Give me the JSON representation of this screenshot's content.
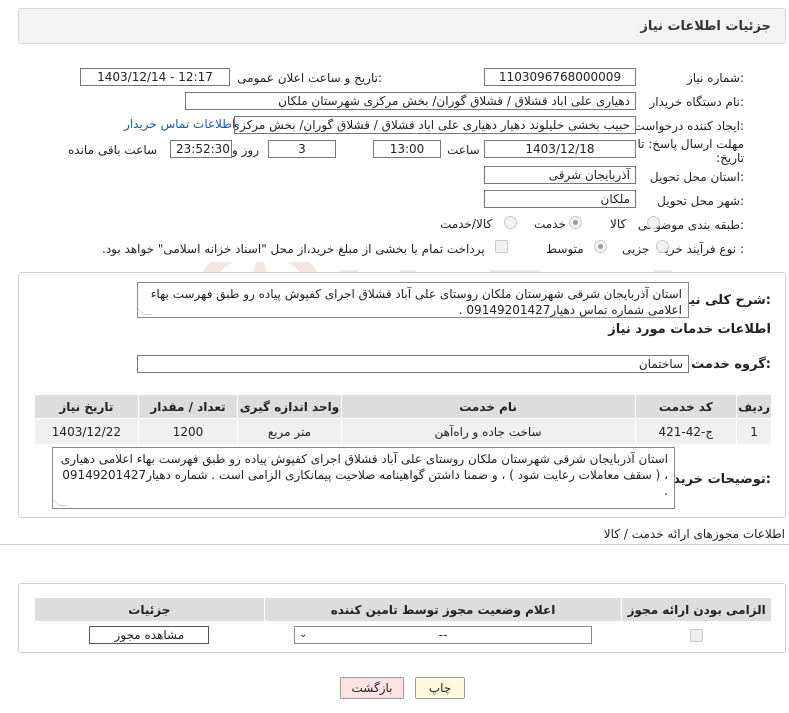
{
  "header": {
    "title": "جزئیات اطلاعات نیاز"
  },
  "form": {
    "need_number_label": "شماره نیاز:",
    "need_number": "1103096768000009",
    "announce_label": "تاریخ و ساعت اعلان عمومی:",
    "announce_value": "1403/12/14 - 12:17",
    "buyer_org_label": "نام دستگاه خریدار:",
    "buyer_org": "دهیاری علی اباد قشلاق / قشلاق گوران/ بخش مرکزی شهرستان ملکان",
    "requester_label": "ایجاد کننده درخواست:",
    "requester": "حبیب بخشی خلیلوند دهیار دهیاری علی اباد قشلاق / قشلاق گوران/ بخش مرکزی شهرستان ملکان",
    "contact_link": "اطلاعات تماس خریدار",
    "deadline_label": "مهلت ارسال پاسخ: تا تاریخ:",
    "deadline_date": "1403/12/18",
    "time_label": "ساعت",
    "deadline_time": "13:00",
    "days_value": "3",
    "days_label": "روز و",
    "remaining_time": "23:52:30",
    "remaining_label": "ساعت باقی مانده",
    "province_label": "استان محل تحویل:",
    "province": "آذربایجان شرقی",
    "city_label": "شهر محل تحویل:",
    "city": "ملکان",
    "category_label": "طبقه بندی موضوعی:",
    "category_options": [
      "کالا",
      "خدمت",
      "کالا/خدمت"
    ],
    "process_label": "نوع فرآیند خرید :",
    "process_options": [
      "جزیی",
      "متوسط"
    ],
    "payment_note": "پرداخت تمام یا بخشی از مبلغ خرید،از محل \"اسناد خزانه اسلامی\" خواهد بود."
  },
  "summary": {
    "label": "شرح کلی نیاز:",
    "text": "استان آذربایجان شرقی شهرستان ملکان روستای علی آباد قشلاق اجرای کفپوش پیاده رو  طبق فهرست بهاء اعلامی  شماره تماس دهیار09149201427 ."
  },
  "services": {
    "section_title": "اطلاعات خدمات مورد نیاز",
    "group_label": "گروه خدمت:",
    "group_value": "ساختمان",
    "columns": [
      "ردیف",
      "کد خدمت",
      "نام خدمت",
      "واحد اندازه گیری",
      "تعداد / مقدار",
      "تاریخ نیاز"
    ],
    "rows": [
      [
        "1",
        "ج-42-421",
        "ساخت جاده و راه‌آهن",
        "متر مربع",
        "1200",
        "1403/12/22"
      ]
    ]
  },
  "buyer_notes": {
    "label": "توضیحات خریدار:",
    "text": "استان آذربایجان شرقی شهرستان ملکان روستای علی آباد قشلاق اجرای کفپوش پیاده رو  طبق فهرست بهاء اعلامی دهیاری ، ( سقف معاملات رعایت شود ) ، و ضمنا داشتن گواهینامه صلاحیت پیمانکاری الزامی است . شماره دهیار09149201427 ."
  },
  "permits": {
    "section_title": "اطلاعات مجوزهای ارائه خدمت / کالا",
    "columns": [
      "الزامی بودن ارائه مجوز",
      "اعلام وضعیت مجوز توسط تامین کننده",
      "جزئیات"
    ],
    "select_value": "--",
    "view_button": "مشاهده مجوز"
  },
  "footer": {
    "print_button": "چاپ",
    "back_button": "بازگشت"
  },
  "colors": {
    "back_button_bg": "#fde3e3",
    "print_button_bg": "#fff8dc",
    "link": "#1a5aa6"
  }
}
